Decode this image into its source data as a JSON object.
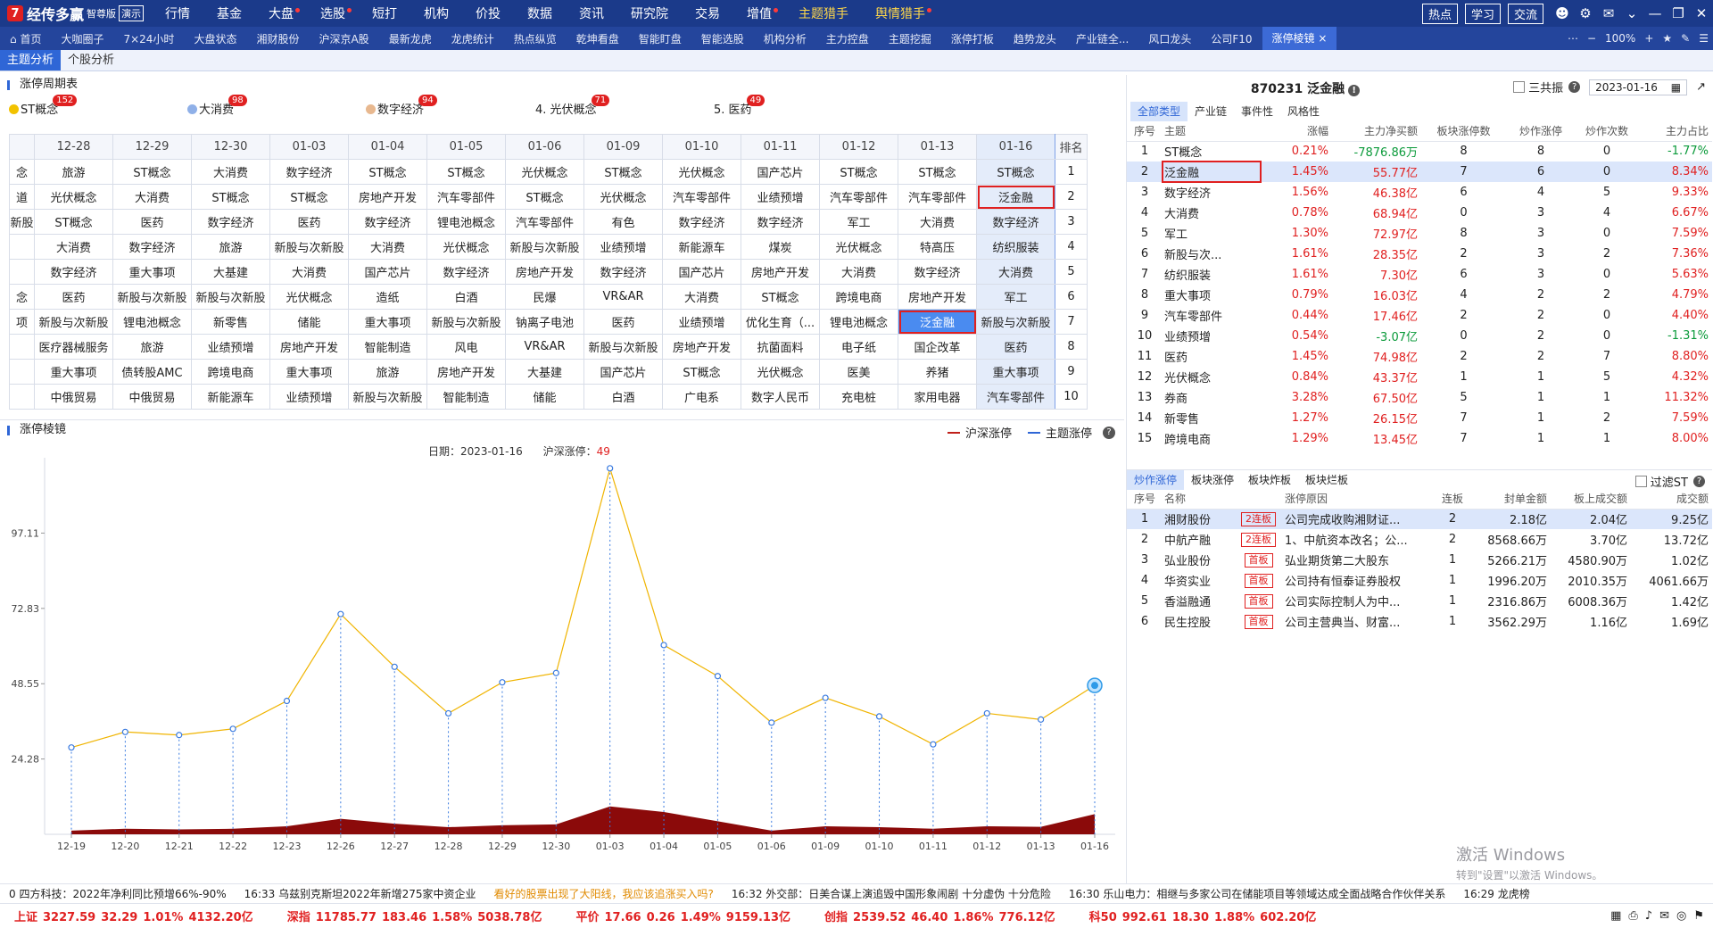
{
  "app": {
    "logo_mark": "7",
    "name": "经传多赢",
    "edition": "智尊版",
    "demo": "演示",
    "menu": [
      {
        "label": "行情",
        "hl": false,
        "dot": false
      },
      {
        "label": "基金",
        "hl": false,
        "dot": false
      },
      {
        "label": "大盘",
        "hl": false,
        "dot": true
      },
      {
        "label": "选股",
        "hl": false,
        "dot": true
      },
      {
        "label": "短打",
        "hl": false,
        "dot": false
      },
      {
        "label": "机构",
        "hl": false,
        "dot": false
      },
      {
        "label": "价投",
        "hl": false,
        "dot": false
      },
      {
        "label": "数据",
        "hl": false,
        "dot": false
      },
      {
        "label": "资讯",
        "hl": false,
        "dot": false
      },
      {
        "label": "研究院",
        "hl": false,
        "dot": false
      },
      {
        "label": "交易",
        "hl": false,
        "dot": false
      },
      {
        "label": "增值",
        "hl": false,
        "dot": true
      },
      {
        "label": "主题猎手",
        "hl": true,
        "dot": false
      },
      {
        "label": "舆情猎手",
        "hl": true,
        "dot": true
      }
    ],
    "right_buttons": [
      "热点",
      "学习",
      "交流"
    ]
  },
  "nav": {
    "items": [
      "首页",
      "大咖圈子",
      "7×24小时",
      "大盘状态",
      "湘财股份",
      "沪深京A股",
      "最新龙虎",
      "龙虎统计",
      "热点纵览",
      "乾坤看盘",
      "智能盯盘",
      "智能选股",
      "机构分析",
      "主力控盘",
      "主题挖掘",
      "涨停打板",
      "趋势龙头",
      "产业链全...",
      "风口龙头",
      "公司F10",
      "涨停棱镜"
    ],
    "active_index": 20,
    "zoom": "100%"
  },
  "tabs": {
    "items": [
      "主题分析",
      "个股分析"
    ],
    "active_index": 0
  },
  "cycle": {
    "title": "涨停周期表",
    "themes": [
      {
        "label": "ST概念",
        "badge": "152",
        "mark": "#f2c200"
      },
      {
        "label": "大消费",
        "badge": "98",
        "mark": "#8fb0e8"
      },
      {
        "label": "数字经济",
        "badge": "94",
        "mark": "#e8b88f"
      },
      {
        "label": "4. 光伏概念",
        "badge": "71",
        "mark": ""
      },
      {
        "label": "5. 医药",
        "badge": "49",
        "mark": ""
      }
    ],
    "dates": [
      "12-28",
      "12-29",
      "12-30",
      "01-03",
      "01-04",
      "01-05",
      "01-06",
      "01-09",
      "01-10",
      "01-11",
      "01-12",
      "01-13",
      "01-16"
    ],
    "rank_header": "排名",
    "lead_col": [
      "念",
      "道",
      "新股",
      "",
      "",
      "念",
      "项",
      "",
      "",
      ""
    ],
    "rows": [
      [
        "旅游",
        "ST概念",
        "大消费",
        "数字经济",
        "ST概念",
        "ST概念",
        "光伏概念",
        "ST概念",
        "光伏概念",
        "国产芯片",
        "ST概念",
        "ST概念",
        "ST概念"
      ],
      [
        "光伏概念",
        "大消费",
        "ST概念",
        "ST概念",
        "房地产开发",
        "汽车零部件",
        "ST概念",
        "光伏概念",
        "汽车零部件",
        "业绩预增",
        "汽车零部件",
        "汽车零部件",
        "泛金融"
      ],
      [
        "ST概念",
        "医药",
        "数字经济",
        "医药",
        "数字经济",
        "锂电池概念",
        "汽车零部件",
        "有色",
        "数字经济",
        "数字经济",
        "军工",
        "大消费",
        "数字经济"
      ],
      [
        "大消费",
        "数字经济",
        "旅游",
        "新股与次新股",
        "大消费",
        "光伏概念",
        "新股与次新股",
        "业绩预增",
        "新能源车",
        "煤炭",
        "光伏概念",
        "特高压",
        "纺织服装"
      ],
      [
        "数字经济",
        "重大事项",
        "大基建",
        "大消费",
        "国产芯片",
        "数字经济",
        "房地产开发",
        "数字经济",
        "国产芯片",
        "房地产开发",
        "大消费",
        "数字经济",
        "大消费"
      ],
      [
        "医药",
        "新股与次新股",
        "新股与次新股",
        "光伏概念",
        "造纸",
        "白酒",
        "民爆",
        "VR&AR",
        "大消费",
        "ST概念",
        "跨境电商",
        "房地产开发",
        "军工"
      ],
      [
        "新股与次新股",
        "锂电池概念",
        "新零售",
        "储能",
        "重大事项",
        "新股与次新股",
        "钠离子电池",
        "医药",
        "业绩预增",
        "优化生育（...",
        "锂电池概念",
        "泛金融",
        "新股与次新股"
      ],
      [
        "医疗器械服务",
        "旅游",
        "业绩预增",
        "房地产开发",
        "智能制造",
        "风电",
        "VR&AR",
        "新股与次新股",
        "房地产开发",
        "抗菌面料",
        "电子纸",
        "国企改革",
        "医药"
      ],
      [
        "重大事项",
        "债转股AMC",
        "跨境电商",
        "重大事项",
        "旅游",
        "房地产开发",
        "大基建",
        "国产芯片",
        "ST概念",
        "光伏概念",
        "医美",
        "养猪",
        "重大事项"
      ],
      [
        "中俄贸易",
        "中俄贸易",
        "新能源车",
        "业绩预增",
        "新股与次新股",
        "智能制造",
        "储能",
        "白酒",
        "广电系",
        "数字人民币",
        "充电桩",
        "家用电器",
        "汽车零部件"
      ]
    ],
    "ranks": [
      "1",
      "2",
      "3",
      "4",
      "5",
      "6",
      "7",
      "8",
      "9",
      "10"
    ]
  },
  "trend": {
    "title": "涨停棱镜",
    "legend": [
      "沪深涨停",
      "主题涨停"
    ],
    "legend_colors": [
      "#c0201a",
      "#2f66d6"
    ],
    "info_date_label": "日期：",
    "info_date": "2023-01-16",
    "info_count_label": "沪深涨停：",
    "info_count": "49"
  },
  "chart_data": {
    "type": "line",
    "x": [
      "12-19",
      "12-20",
      "12-21",
      "12-22",
      "12-23",
      "12-26",
      "12-27",
      "12-28",
      "12-29",
      "12-30",
      "01-03",
      "01-04",
      "01-05",
      "01-06",
      "01-09",
      "01-10",
      "01-11",
      "01-12",
      "01-13",
      "01-16"
    ],
    "series": [
      {
        "name": "沪深涨停",
        "color": "#f0b400",
        "values": [
          28,
          33,
          32,
          34,
          43,
          71,
          54,
          39,
          49,
          52,
          118,
          61,
          51,
          36,
          44,
          38,
          29,
          39,
          37,
          48
        ]
      },
      {
        "name": "主题涨停",
        "color": "#8b0a0a",
        "values": [
          1.2,
          1.8,
          1.6,
          1.8,
          2.6,
          5.0,
          3.4,
          2.3,
          2.9,
          3.2,
          9.0,
          7.2,
          4.2,
          1.2,
          2.6,
          2.3,
          1.8,
          2.6,
          2.4,
          6.5
        ]
      }
    ],
    "yticks": [
      "24.28",
      "48.55",
      "72.83",
      "97.11"
    ],
    "ylim": [
      0,
      121.4
    ],
    "grid": false
  },
  "detail": {
    "title": "870231 泛金融",
    "sanrongzhen": "三共振",
    "date": "2023-01-16",
    "subtabs": [
      "全部类型",
      "产业链",
      "事件性",
      "风格性"
    ],
    "active_subtab": 0,
    "headers": [
      "序号",
      "主题",
      "涨幅",
      "主力净买额",
      "板块涨停数",
      "炒作涨停",
      "炒作次数",
      "主力占比"
    ],
    "rows": [
      [
        "1",
        "ST概念",
        "0.21%",
        "-7876.86万",
        "8",
        "8",
        "0",
        "-1.77%"
      ],
      [
        "2",
        "泛金融",
        "1.45%",
        "55.77亿",
        "7",
        "6",
        "0",
        "8.34%"
      ],
      [
        "3",
        "数字经济",
        "1.56%",
        "46.38亿",
        "6",
        "4",
        "5",
        "9.33%"
      ],
      [
        "4",
        "大消费",
        "0.78%",
        "68.94亿",
        "0",
        "3",
        "4",
        "6.67%"
      ],
      [
        "5",
        "军工",
        "1.30%",
        "72.97亿",
        "8",
        "3",
        "0",
        "7.59%"
      ],
      [
        "6",
        "新股与次...",
        "1.61%",
        "28.35亿",
        "2",
        "3",
        "2",
        "7.36%"
      ],
      [
        "7",
        "纺织服装",
        "1.61%",
        "7.30亿",
        "6",
        "3",
        "0",
        "5.63%"
      ],
      [
        "8",
        "重大事项",
        "0.79%",
        "16.03亿",
        "4",
        "2",
        "2",
        "4.79%"
      ],
      [
        "9",
        "汽车零部件",
        "0.44%",
        "17.46亿",
        "2",
        "2",
        "0",
        "4.40%"
      ],
      [
        "10",
        "业绩预增",
        "0.54%",
        "-3.07亿",
        "0",
        "2",
        "0",
        "-1.31%"
      ],
      [
        "11",
        "医药",
        "1.45%",
        "74.98亿",
        "2",
        "2",
        "7",
        "8.80%"
      ],
      [
        "12",
        "光伏概念",
        "0.84%",
        "43.37亿",
        "1",
        "1",
        "5",
        "4.32%"
      ],
      [
        "13",
        "券商",
        "3.28%",
        "67.50亿",
        "5",
        "1",
        "1",
        "11.32%"
      ],
      [
        "14",
        "新零售",
        "1.27%",
        "26.15亿",
        "7",
        "1",
        "2",
        "7.59%"
      ],
      [
        "15",
        "跨境电商",
        "1.29%",
        "13.45亿",
        "7",
        "1",
        "1",
        "8.00%"
      ]
    ],
    "selected_row": 1
  },
  "stocks": {
    "subtabs": [
      "炒作涨停",
      "板块涨停",
      "板块炸板",
      "板块烂板"
    ],
    "active_subtab": 0,
    "filter_label": "过滤ST",
    "headers": [
      "序号",
      "名称",
      "",
      "涨停原因",
      "连板",
      "封单金额",
      "板上成交额",
      "成交额"
    ],
    "rows": [
      [
        "1",
        "湘财股份",
        "2连板",
        "公司完成收购湘财证...",
        "2",
        "2.18亿",
        "2.04亿",
        "9.25亿"
      ],
      [
        "2",
        "中航产融",
        "2连板",
        "1、中航资本改名；公...",
        "2",
        "8568.66万",
        "3.70亿",
        "13.72亿"
      ],
      [
        "3",
        "弘业股份",
        "首板",
        "弘业期货第二大股东",
        "1",
        "5266.21万",
        "4580.90万",
        "1.02亿"
      ],
      [
        "4",
        "华资实业",
        "首板",
        "公司持有恒泰证券股权",
        "1",
        "1996.20万",
        "2010.35万",
        "4061.66万"
      ],
      [
        "5",
        "香溢融通",
        "首板",
        "公司实际控制人为中...",
        "1",
        "2316.86万",
        "6008.36万",
        "1.42亿"
      ],
      [
        "6",
        "民生控股",
        "首板",
        "公司主营典当、财富...",
        "1",
        "3562.29万",
        "1.16亿",
        "1.69亿"
      ]
    ],
    "selected_row": 0
  },
  "watermark": {
    "line1": "激活 Windows",
    "line2": "转到\"设置\"以激活 Windows。"
  },
  "ticker": [
    {
      "text": "0 四方科技：2022年净利同比预增66%-90%",
      "hl": false
    },
    {
      "text": "16:33 乌兹别克斯坦2022年新增275家中资企业",
      "hl": false
    },
    {
      "text": "看好的股票出现了大阳线，我应该追涨买入吗?",
      "hl": true
    },
    {
      "text": "16:32 外交部：日美合谋上演追毁中国形象闹剧 十分虚伪 十分危险",
      "hl": false
    },
    {
      "text": "16:30 乐山电力：相继与多家公司在储能项目等领域达成全面战略合作伙伴关系",
      "hl": false
    },
    {
      "text": "16:29 龙虎榜",
      "hl": false
    }
  ],
  "status": [
    {
      "name": "上证",
      "vals": [
        "3227.59",
        "32.29",
        "1.01%",
        "4132.20亿"
      ]
    },
    {
      "name": "深指",
      "vals": [
        "11785.77",
        "183.46",
        "1.58%",
        "5038.78亿"
      ]
    },
    {
      "name": "平价",
      "vals": [
        "17.66",
        "0.26",
        "1.49%",
        "9159.13亿"
      ]
    },
    {
      "name": "创指",
      "vals": [
        "2539.52",
        "46.40",
        "1.86%",
        "776.12亿"
      ]
    },
    {
      "name": "科50",
      "vals": [
        "992.61",
        "18.30",
        "1.88%",
        "602.20亿"
      ]
    }
  ]
}
